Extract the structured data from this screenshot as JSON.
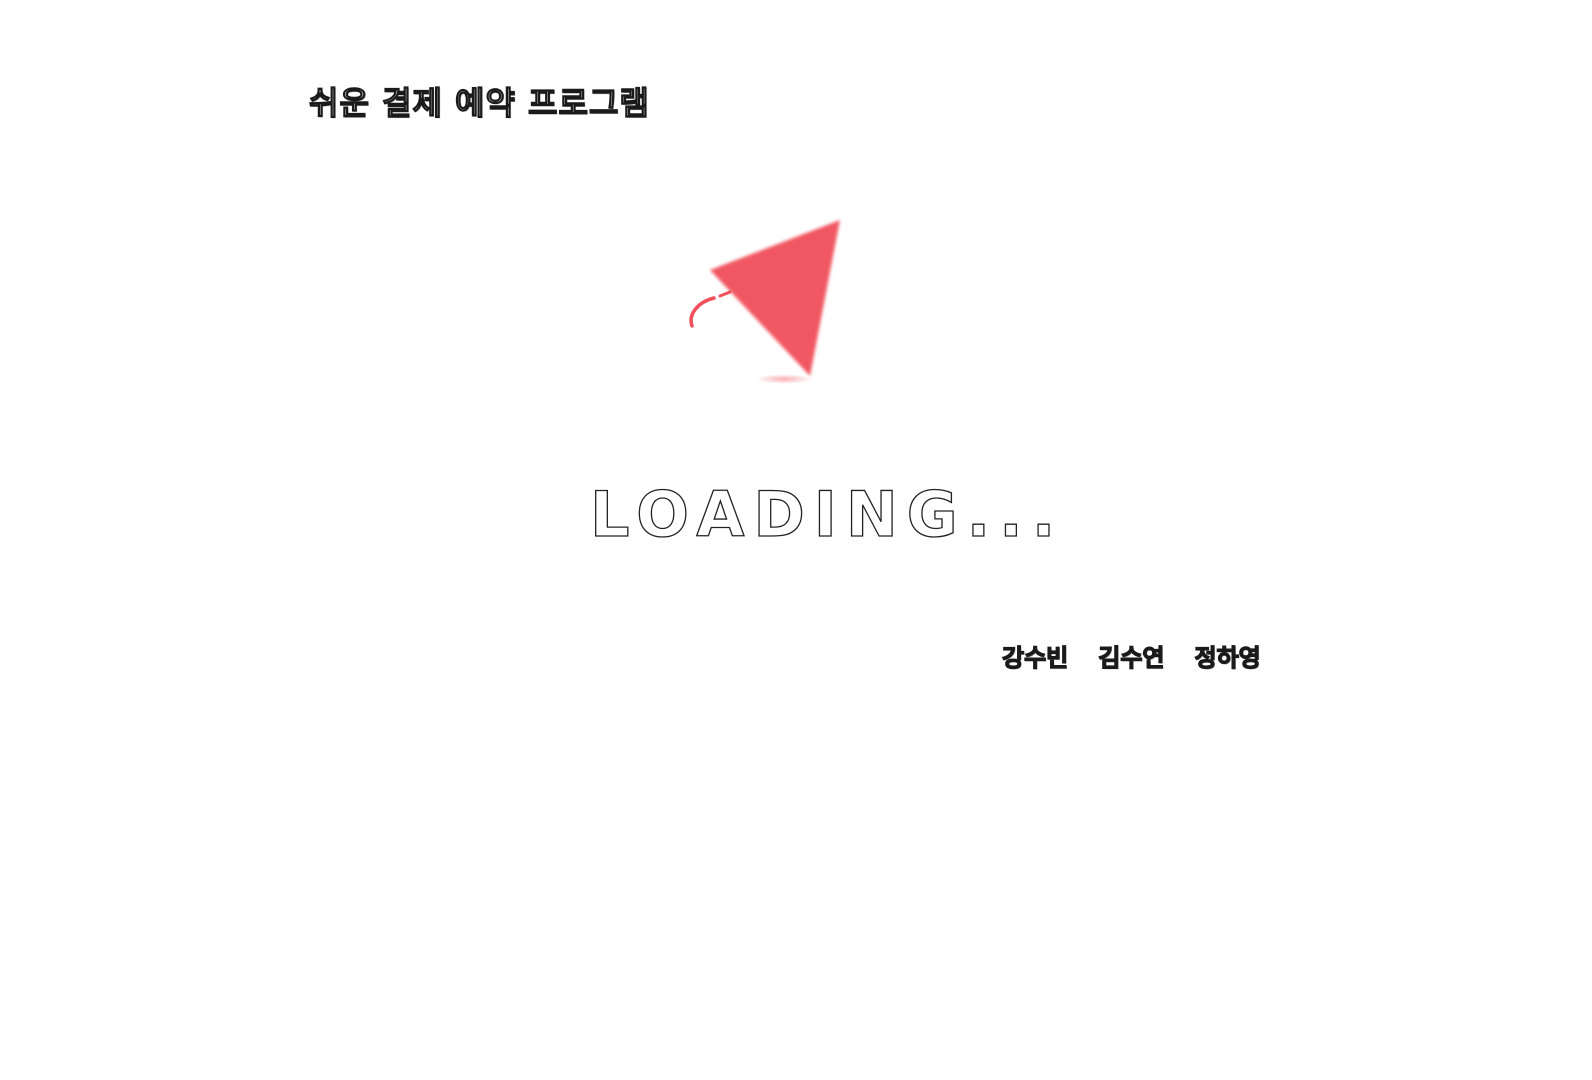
{
  "app_title": "쉬운 결제 예약 프로그램",
  "loading": {
    "label": "LOADING...",
    "accent_color": "#f0505a"
  },
  "credits": [
    "강수빈",
    "김수연",
    "정하영"
  ]
}
